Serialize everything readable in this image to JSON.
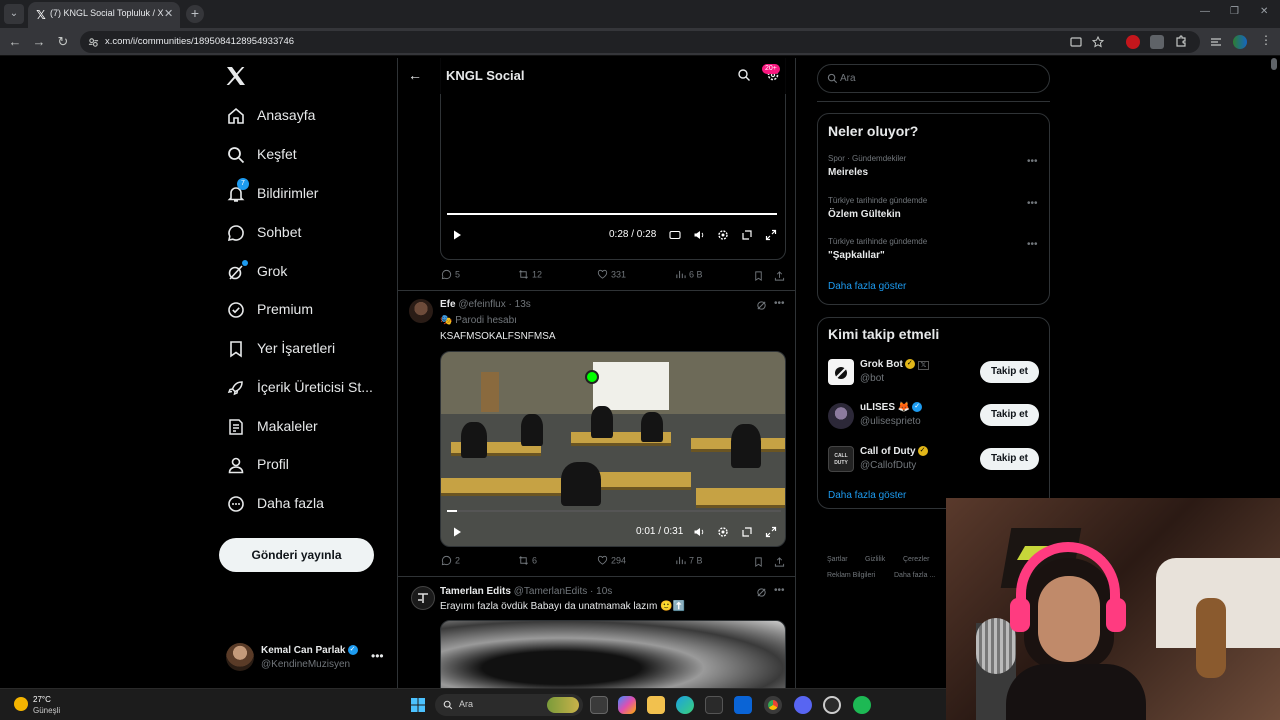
{
  "browser": {
    "tab_title": "(7) KNGL Social Topluluk / X",
    "url": "x.com/i/communities/1895084128954933746",
    "new_tab": "+",
    "tab_close": "✕"
  },
  "nav": {
    "items": [
      {
        "label": "Anasayfa",
        "icon": "home-icon"
      },
      {
        "label": "Keşfet",
        "icon": "search-icon"
      },
      {
        "label": "Bildirimler",
        "icon": "bell-icon",
        "badge": "7"
      },
      {
        "label": "Sohbet",
        "icon": "chat-icon"
      },
      {
        "label": "Grok",
        "icon": "grok-icon"
      },
      {
        "label": "Premium",
        "icon": "premium-icon"
      },
      {
        "label": "Yer İşaretleri",
        "icon": "bookmark-icon"
      },
      {
        "label": "İçerik Üreticisi St...",
        "icon": "rocket-icon"
      },
      {
        "label": "Makaleler",
        "icon": "article-icon"
      },
      {
        "label": "Profil",
        "icon": "person-icon"
      },
      {
        "label": "Daha fazla",
        "icon": "more-circle-icon"
      }
    ],
    "post_button": "Gönderi yayınla",
    "account": {
      "name": "Kemal Can Parlak",
      "handle": "@KendineMuzisyen"
    }
  },
  "main": {
    "title": "KNGL Social",
    "header_badge": "20+",
    "post0": {
      "video_time": "0:28 / 0:28",
      "progress": 1.0,
      "replies": "5",
      "reposts": "12",
      "likes": "331",
      "views": "6 B"
    },
    "post1": {
      "name": "Efe",
      "handle": "@efeinflux",
      "time": "· 13s",
      "label": "Parodi hesabı",
      "text": "KSAFMSOKALFSNFMSA",
      "video_time": "0:01 / 0:31",
      "progress": 0.03,
      "replies": "2",
      "reposts": "6",
      "likes": "294",
      "views": "7 B"
    },
    "post2": {
      "name": "Tamerlan Edits",
      "handle": "@TamerlanEdits",
      "time": "· 10s",
      "text": "Erayımı fazla övdük Babayı da unatmamak lazım 🙂⬆️"
    }
  },
  "right": {
    "search_placeholder": "Ara",
    "trends_title": "Neler oluyor?",
    "trends": [
      {
        "context": "Spor · Gündemdekiler",
        "name": "Meireles"
      },
      {
        "context": "Türkiye tarihinde gündemde",
        "name": "Özlem Gültekin"
      },
      {
        "context": "Türkiye tarihinde gündemde",
        "name": "\"Şapkalılar\""
      }
    ],
    "trends_more": "Daha fazla göster",
    "wtf_title": "Kimi takip etmeli",
    "wtf": [
      {
        "name": "Grok Bot",
        "handle": "@bot",
        "button": "Takip et"
      },
      {
        "name": "uLISES 🦊",
        "handle": "@ulisesprieto",
        "button": "Takip et"
      },
      {
        "name": "Call of Duty",
        "handle": "@CallofDuty",
        "button": "Takip et"
      }
    ],
    "wtf_more": "Daha fazla göster",
    "footer": [
      "Şartlar",
      "Gizlilik",
      "Çerezler",
      "Reklam Bilgileri",
      "Daha fazla ..."
    ]
  },
  "taskbar": {
    "weather_temp": "27°C",
    "weather_desc": "Güneşli",
    "search_placeholder": "Ara"
  },
  "colors": {
    "accent": "#1d9bf0",
    "badge": "#f91880",
    "gold": "#e2b719"
  }
}
